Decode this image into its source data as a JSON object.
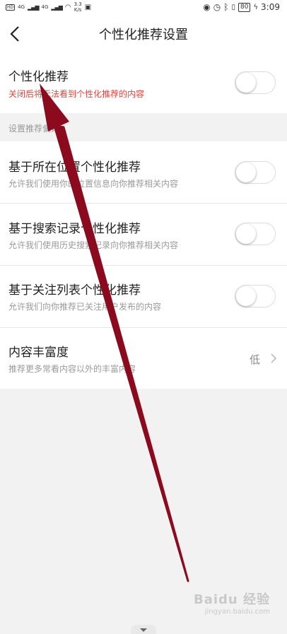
{
  "statusbar": {
    "network_left": "4G",
    "network_right": "4G",
    "speed": "3.3",
    "speed_unit": "K/s",
    "battery": "80",
    "time": "3:09"
  },
  "header": {
    "title": "个性化推荐设置"
  },
  "main_toggle": {
    "label": "个性化推荐",
    "sub": "关闭后将无法看到个性化推荐的内容"
  },
  "group_label": "设置推荐偏好",
  "settings": [
    {
      "label": "基于所在位置个性化推荐",
      "sub": "允许我们使用你的位置信息向你推荐相关内容"
    },
    {
      "label": "基于搜索记录个性化推荐",
      "sub": "允许我们使用历史搜索记录向你推荐相关内容"
    },
    {
      "label": "基于关注列表个性化推荐",
      "sub": "允许我们向你推荐已关注用户发布的内容"
    }
  ],
  "richness": {
    "label": "内容丰富度",
    "sub": "推荐更多常看内容以外的丰富内容",
    "value": "低"
  },
  "watermark": {
    "brand": "Baidu 经验",
    "url": "jingyan.baidu.com"
  },
  "colors": {
    "arrow": "#8b0a1e",
    "warning_text": "#e0463c"
  }
}
